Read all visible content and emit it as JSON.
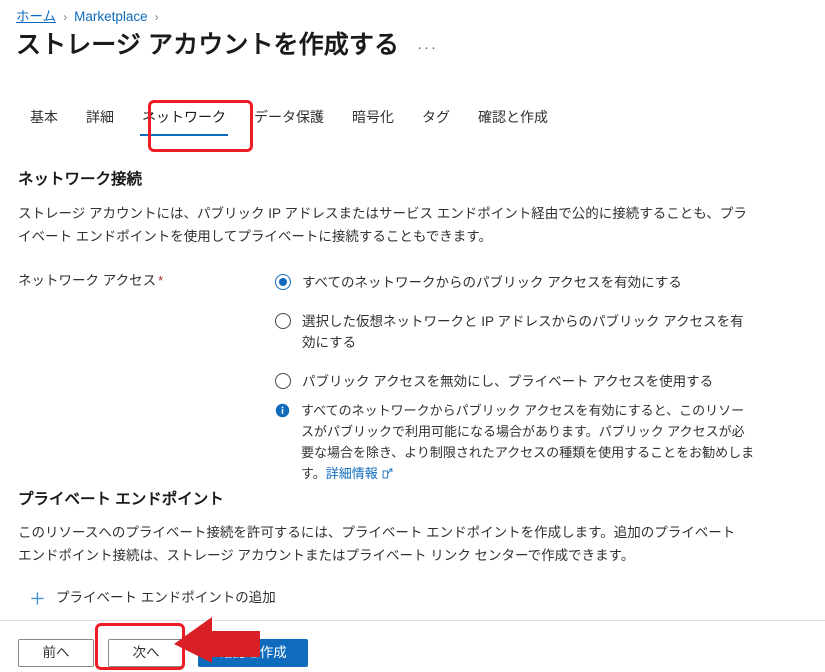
{
  "breadcrumb": {
    "items": [
      {
        "label": "ホーム",
        "separator": "›"
      },
      {
        "label": "Marketplace",
        "separator": "›"
      }
    ]
  },
  "header": {
    "title": "ストレージ アカウントを作成する",
    "more_menu": "···"
  },
  "tabs": [
    {
      "label": "基本",
      "active": false
    },
    {
      "label": "詳細",
      "active": false
    },
    {
      "label": "ネットワーク",
      "active": true
    },
    {
      "label": "データ保護",
      "active": false
    },
    {
      "label": "暗号化",
      "active": false
    },
    {
      "label": "タグ",
      "active": false
    },
    {
      "label": "確認と作成",
      "active": false
    }
  ],
  "network_connectivity": {
    "section_title": "ネットワーク接続",
    "section_desc": "ストレージ アカウントには、パブリック IP アドレスまたはサービス エンドポイント経由で公的に接続することも、プライベート エンドポイントを使用してプライベートに接続することもできます。",
    "field_label": "ネットワーク アクセス",
    "required_mark": "*",
    "options": [
      {
        "label": "すべてのネットワークからのパブリック アクセスを有効にする",
        "selected": true
      },
      {
        "label": "選択した仮想ネットワークと IP アドレスからのパブリック アクセスを有効にする",
        "selected": false
      },
      {
        "label": "パブリック アクセスを無効にし、プライベート アクセスを使用する",
        "selected": false
      }
    ],
    "info": {
      "icon": "info-icon",
      "text": "すべてのネットワークからパブリック アクセスを有効にすると、このリソースがパブリックで利用可能になる場合があります。パブリック アクセスが必要な場合を除き、より制限されたアクセスの種類を使用することをお勧めします。",
      "link_label": "詳細情報"
    }
  },
  "private_endpoint": {
    "section_title": "プライベート エンドポイント",
    "section_desc": "このリソースへのプライベート接続を許可するには、プライベート エンドポイントを作成します。追加のプライベート エンドポイント接続は、ストレージ アカウントまたはプライベート リンク センターで作成できます。",
    "add_label": "プライベート エンドポイントの追加"
  },
  "footer": {
    "previous_label": "前へ",
    "next_label": "次へ",
    "review_create_label": "確認と作成"
  },
  "annotations": {
    "tab_highlight_color": "#ee1c25",
    "next_highlight_color": "#ee1c25",
    "arrow_color": "#d81f26"
  },
  "colors": {
    "accent": "#0f6cbd",
    "text": "#323130",
    "required": "#a4262c",
    "divider": "#e1dfdd"
  }
}
